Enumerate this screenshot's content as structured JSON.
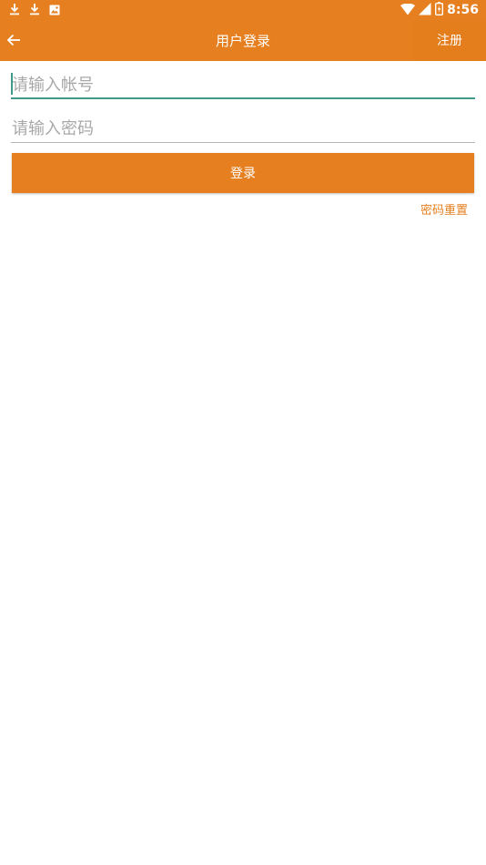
{
  "status_bar": {
    "time": "8:56",
    "left_icons": [
      "download-icon",
      "download-icon",
      "image-notification-icon"
    ],
    "right_icons": [
      "wifi-icon",
      "signal-icon",
      "battery-icon"
    ]
  },
  "app_bar": {
    "title": "用户登录",
    "back_icon": "arrow-left-icon",
    "register_label": "注册"
  },
  "form": {
    "account_placeholder": "请输入帐号",
    "account_value": "",
    "password_placeholder": "请输入密码",
    "password_value": "",
    "login_label": "登录",
    "reset_label": "密码重置"
  },
  "colors": {
    "primary": "#e57f1f",
    "focus": "#3f9a8c",
    "placeholder": "#a8a8a8"
  }
}
